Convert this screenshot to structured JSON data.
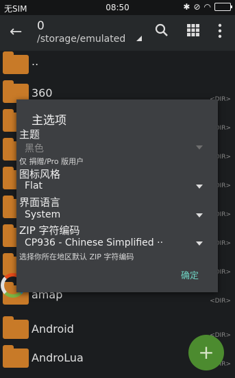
{
  "statusbar": {
    "carrier": "无SIM",
    "time": "08:50"
  },
  "toolbar": {
    "count": "0",
    "path": "/storage/emulated"
  },
  "files": [
    {
      "name": "..",
      "kind": "up"
    },
    {
      "name": "360",
      "tag": "<DIR>"
    },
    {
      "name": "",
      "tag": "<DIR>"
    },
    {
      "name": "",
      "tag": "<DIR>"
    },
    {
      "name": "",
      "tag": "<DIR>"
    },
    {
      "name": "",
      "tag": "<DIR>"
    },
    {
      "name": "",
      "tag": "<DIR>"
    },
    {
      "name": "",
      "tag": "<DIR>"
    },
    {
      "name": "amap",
      "tag": "<DIR>"
    },
    {
      "name": "Android",
      "tag": "<DIR>"
    },
    {
      "name": "AndroLua",
      "tag": "<DIR>"
    }
  ],
  "dialog": {
    "title": "主选项",
    "theme_label": "主题",
    "theme_value": "黑色",
    "theme_hint": "仅 捐赠/Pro 版用户",
    "icon_style_label": "图标风格",
    "icon_style_value": "Flat",
    "language_label": "界面语言",
    "language_value": "System",
    "zip_label": "ZIP 字符编码",
    "zip_value": "CP936 - Chinese Simplified ··",
    "zip_hint": "选择你所在地区默认 ZIP 字符编码",
    "ok_label": "确定"
  },
  "fab": {
    "symbol": "+"
  }
}
